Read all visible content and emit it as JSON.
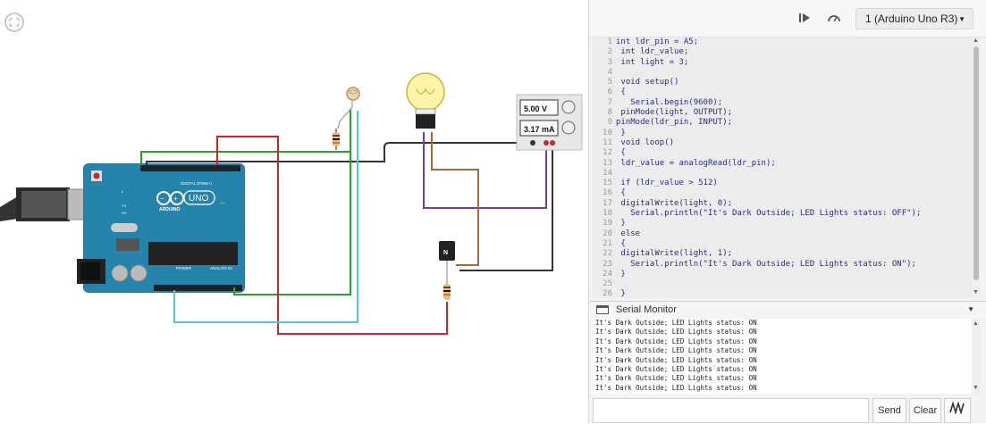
{
  "toolbar": {
    "play_icon": "step-play-icon",
    "debug_icon": "debug-gauge-icon",
    "board_selected": "1 (Arduino Uno R3)"
  },
  "canvas": {
    "fullscreen_icon": "fullscreen-icon",
    "power_supply": {
      "voltage": "5.00 V",
      "current": "3.17 mA"
    },
    "arduino": {
      "brand": "UNO",
      "sub": "ARDUINO",
      "digital_label": "DIGITAL (PWM~)",
      "power_label": "POWER",
      "analog_label": "ANALOG IN",
      "tx": "TX",
      "rx": "RX",
      "l": "L",
      "on": "ON"
    },
    "transistor_label": "N"
  },
  "code": {
    "lines": [
      {
        "n": "1",
        "t": "int ldr_pin = A5;"
      },
      {
        "n": "2",
        "t": " int ldr_value;"
      },
      {
        "n": "3",
        "t": " int light = 3;"
      },
      {
        "n": "4",
        "t": ""
      },
      {
        "n": "5",
        "t": " void setup()"
      },
      {
        "n": "6",
        "t": " {"
      },
      {
        "n": "7",
        "t": "   Serial.begin(9600);"
      },
      {
        "n": "8",
        "t": " pinMode(light, OUTPUT);"
      },
      {
        "n": "9",
        "t": "pinMode(ldr_pin, INPUT);"
      },
      {
        "n": "10",
        "t": " }"
      },
      {
        "n": "11",
        "t": " void loop()"
      },
      {
        "n": "12",
        "t": " {"
      },
      {
        "n": "13",
        "t": " ldr_value = analogRead(ldr_pin);"
      },
      {
        "n": "14",
        "t": ""
      },
      {
        "n": "15",
        "t": " if (ldr_value > 512)"
      },
      {
        "n": "16",
        "t": " {"
      },
      {
        "n": "17",
        "t": " digitalWrite(light, 0);"
      },
      {
        "n": "18",
        "t": "   Serial.println(\"It's Dark Outside; LED Lights status: OFF\");"
      },
      {
        "n": "19",
        "t": " }"
      },
      {
        "n": "20",
        "t": " else"
      },
      {
        "n": "21",
        "t": " {"
      },
      {
        "n": "22",
        "t": " digitalWrite(light, 1);"
      },
      {
        "n": "23",
        "t": "   Serial.println(\"It's Dark Outside; LED Lights status: ON\");"
      },
      {
        "n": "24",
        "t": " }"
      },
      {
        "n": "25",
        "t": ""
      },
      {
        "n": "26",
        "t": " }"
      }
    ]
  },
  "serial_monitor": {
    "title": "Serial Monitor",
    "lines": [
      "It's Dark Outside; LED Lights status: ON",
      "It's Dark Outside; LED Lights status: ON",
      "It's Dark Outside; LED Lights status: ON",
      "It's Dark Outside; LED Lights status: ON",
      "It's Dark Outside; LED Lights status: ON",
      "It's Dark Outside; LED Lights status: ON",
      "It's Dark Outside; LED Lights status: ON",
      "It's Dark Outside; LED Lights status: ON"
    ],
    "input_value": "",
    "send_label": "Send",
    "clear_label": "Clear",
    "graph_icon": "graph-icon"
  }
}
